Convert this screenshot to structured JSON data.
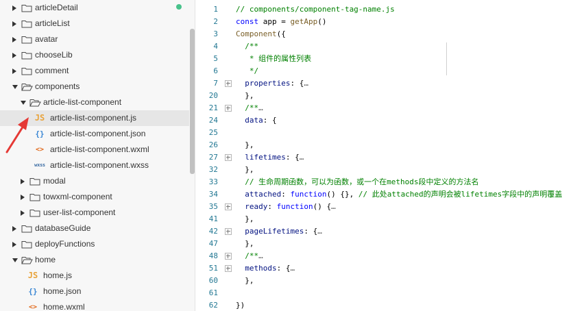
{
  "sidebar": {
    "items": [
      {
        "label": "articleDetail",
        "kind": "folder",
        "expanded": false,
        "depth": 0
      },
      {
        "label": "articleList",
        "kind": "folder",
        "expanded": false,
        "depth": 0
      },
      {
        "label": "avatar",
        "kind": "folder",
        "expanded": false,
        "depth": 0
      },
      {
        "label": "chooseLib",
        "kind": "folder",
        "expanded": false,
        "depth": 0
      },
      {
        "label": "comment",
        "kind": "folder",
        "expanded": false,
        "depth": 0
      },
      {
        "label": "components",
        "kind": "folder",
        "expanded": true,
        "depth": 0
      },
      {
        "label": "article-list-component",
        "kind": "folder",
        "expanded": true,
        "depth": 1
      },
      {
        "label": "article-list-component.js",
        "kind": "file",
        "icon": "JS",
        "icon_name": "js-file-icon",
        "icon_class": "ic-js",
        "depth": 2,
        "selected": true
      },
      {
        "label": "article-list-component.json",
        "kind": "file",
        "icon": "{}",
        "icon_name": "json-file-icon",
        "icon_class": "ic-json",
        "depth": 2
      },
      {
        "label": "article-list-component.wxml",
        "kind": "file",
        "icon": "<>",
        "icon_name": "wxml-file-icon",
        "icon_class": "ic-wxml",
        "depth": 2
      },
      {
        "label": "article-list-component.wxss",
        "kind": "file",
        "icon": "wxss",
        "icon_name": "wxss-file-icon",
        "icon_class": "ic-wxss",
        "depth": 2
      },
      {
        "label": "modal",
        "kind": "folder",
        "expanded": false,
        "depth": 1
      },
      {
        "label": "towxml-component",
        "kind": "folder",
        "expanded": false,
        "depth": 1
      },
      {
        "label": "user-list-component",
        "kind": "folder",
        "expanded": false,
        "depth": 1
      },
      {
        "label": "databaseGuide",
        "kind": "folder",
        "expanded": false,
        "depth": 0
      },
      {
        "label": "deployFunctions",
        "kind": "folder",
        "expanded": false,
        "depth": 0
      },
      {
        "label": "home",
        "kind": "folder",
        "expanded": true,
        "depth": 0
      },
      {
        "label": "home.js",
        "kind": "file",
        "icon": "JS",
        "icon_name": "js-file-icon",
        "icon_class": "ic-js",
        "depth": 1
      },
      {
        "label": "home.json",
        "kind": "file",
        "icon": "{}",
        "icon_name": "json-file-icon",
        "icon_class": "ic-json",
        "depth": 1
      },
      {
        "label": "home.wxml",
        "kind": "file",
        "icon": "<>",
        "icon_name": "wxml-file-icon",
        "icon_class": "ic-wxml",
        "depth": 1
      }
    ]
  },
  "editor": {
    "lines": [
      {
        "n": "1",
        "fold": false,
        "tokens": [
          [
            "// components/component-tag-name.js",
            "t-comment"
          ]
        ]
      },
      {
        "n": "2",
        "fold": false,
        "tokens": [
          [
            "const",
            "t-keyword"
          ],
          [
            " app = ",
            "t-plain"
          ],
          [
            "getApp",
            "t-fn"
          ],
          [
            "()",
            "t-plain"
          ]
        ]
      },
      {
        "n": "3",
        "fold": false,
        "tokens": [
          [
            "Component",
            "t-fn"
          ],
          [
            "({",
            "t-plain"
          ]
        ]
      },
      {
        "n": "4",
        "fold": false,
        "tokens": [
          [
            "  /**",
            "t-comment"
          ]
        ]
      },
      {
        "n": "5",
        "fold": false,
        "tokens": [
          [
            "   * 组件的属性列表",
            "t-comment"
          ]
        ]
      },
      {
        "n": "6",
        "fold": false,
        "tokens": [
          [
            "   */",
            "t-comment"
          ]
        ]
      },
      {
        "n": "7",
        "fold": true,
        "tokens": [
          [
            "  properties",
            "t-prop"
          ],
          [
            ": {",
            "t-plain"
          ],
          [
            "…",
            "t-ellipsis"
          ]
        ]
      },
      {
        "n": "20",
        "fold": false,
        "tokens": [
          [
            "  },",
            "t-plain"
          ]
        ]
      },
      {
        "n": "21",
        "fold": true,
        "tokens": [
          [
            "  /**",
            "t-comment"
          ],
          [
            "…",
            "t-ellipsis"
          ]
        ]
      },
      {
        "n": "24",
        "fold": false,
        "tokens": [
          [
            "  data",
            "t-prop"
          ],
          [
            ": {",
            "t-plain"
          ]
        ]
      },
      {
        "n": "25",
        "fold": false,
        "tokens": [
          [
            "",
            "t-plain"
          ]
        ]
      },
      {
        "n": "26",
        "fold": false,
        "tokens": [
          [
            "  },",
            "t-plain"
          ]
        ]
      },
      {
        "n": "27",
        "fold": true,
        "tokens": [
          [
            "  lifetimes",
            "t-prop"
          ],
          [
            ": {",
            "t-plain"
          ],
          [
            "…",
            "t-ellipsis"
          ]
        ]
      },
      {
        "n": "32",
        "fold": false,
        "tokens": [
          [
            "  },",
            "t-plain"
          ]
        ]
      },
      {
        "n": "33",
        "fold": false,
        "tokens": [
          [
            "  // 生命周期函数，可以为函数，或一个在methods段中定义的方法名",
            "t-comment"
          ]
        ]
      },
      {
        "n": "34",
        "fold": false,
        "tokens": [
          [
            "  attached",
            "t-prop"
          ],
          [
            ": ",
            "t-plain"
          ],
          [
            "function",
            "t-keyword"
          ],
          [
            "() {}, ",
            "t-plain"
          ],
          [
            "// 此处attached的声明会被lifetimes字段中的声明覆盖",
            "t-comment"
          ]
        ]
      },
      {
        "n": "35",
        "fold": true,
        "tokens": [
          [
            "  ready",
            "t-prop"
          ],
          [
            ": ",
            "t-plain"
          ],
          [
            "function",
            "t-keyword"
          ],
          [
            "() {",
            "t-plain"
          ],
          [
            "…",
            "t-ellipsis"
          ]
        ]
      },
      {
        "n": "41",
        "fold": false,
        "tokens": [
          [
            "  },",
            "t-plain"
          ]
        ]
      },
      {
        "n": "42",
        "fold": true,
        "tokens": [
          [
            "  pageLifetimes",
            "t-prop"
          ],
          [
            ": {",
            "t-plain"
          ],
          [
            "…",
            "t-ellipsis"
          ]
        ]
      },
      {
        "n": "47",
        "fold": false,
        "tokens": [
          [
            "  },",
            "t-plain"
          ]
        ]
      },
      {
        "n": "48",
        "fold": true,
        "tokens": [
          [
            "  /**",
            "t-comment"
          ],
          [
            "…",
            "t-ellipsis"
          ]
        ]
      },
      {
        "n": "51",
        "fold": true,
        "tokens": [
          [
            "  methods",
            "t-prop"
          ],
          [
            ": {",
            "t-plain"
          ],
          [
            "…",
            "t-ellipsis"
          ]
        ]
      },
      {
        "n": "60",
        "fold": false,
        "tokens": [
          [
            "  },",
            "t-plain"
          ]
        ]
      },
      {
        "n": "61",
        "fold": false,
        "tokens": [
          [
            "",
            "t-plain"
          ]
        ]
      },
      {
        "n": "62",
        "fold": false,
        "tokens": [
          [
            "})",
            "t-plain"
          ]
        ]
      }
    ]
  },
  "colors": {
    "comment": "#008000",
    "keyword": "#0000ff",
    "line_number": "#237893",
    "status_dot": "#48c28b",
    "annotation_arrow": "#e53935",
    "selected_row": "#e6e6e6"
  }
}
